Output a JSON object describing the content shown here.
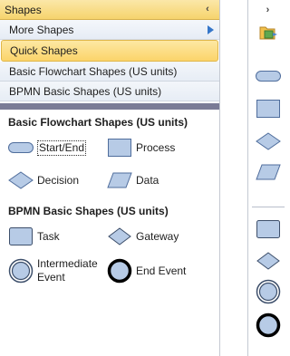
{
  "panel": {
    "title": "Shapes",
    "more_shapes": "More Shapes",
    "quick_shapes": "Quick Shapes",
    "stencils": [
      "Basic Flowchart Shapes (US units)",
      "BPMN Basic Shapes (US units)"
    ]
  },
  "sections": [
    {
      "title": "Basic Flowchart Shapes (US units)",
      "shapes": [
        {
          "label": "Start/End",
          "icon": "terminator-icon"
        },
        {
          "label": "Process",
          "icon": "process-icon"
        },
        {
          "label": "Decision",
          "icon": "decision-icon"
        },
        {
          "label": "Data",
          "icon": "data-icon"
        }
      ]
    },
    {
      "title": "BPMN Basic Shapes (US units)",
      "shapes": [
        {
          "label": "Task",
          "icon": "task-icon"
        },
        {
          "label": "Gateway",
          "icon": "gateway-icon"
        },
        {
          "label": "Intermediate Event",
          "icon": "intermediate-event-icon"
        },
        {
          "label": "End Event",
          "icon": "end-event-icon"
        }
      ]
    }
  ],
  "colors": {
    "header": "#f6d46d",
    "shape_fill": "#b7cbe6",
    "shape_stroke": "#4f6d9c",
    "divider": "#7a7b96",
    "arrow": "#3576c9"
  }
}
